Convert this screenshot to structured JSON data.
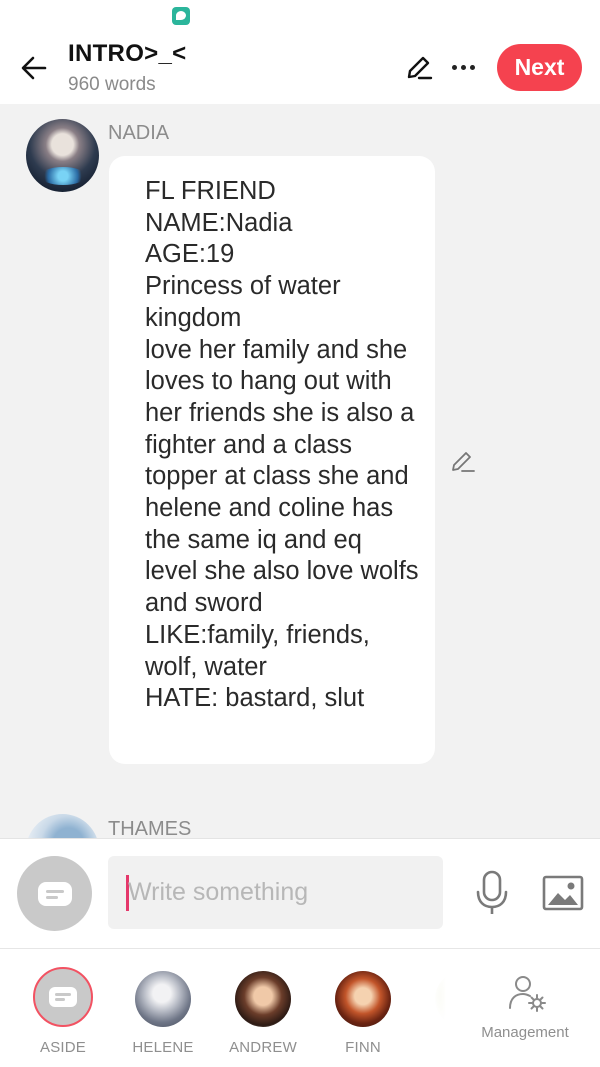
{
  "status_bar": {
    "app_icon": "chat-bubble-icon"
  },
  "header": {
    "title": "INTRO>_<",
    "word_count": "960 words",
    "back_icon": "arrow-left-icon",
    "edit_icon": "pencil-icon",
    "more_icon": "ellipsis-icon",
    "next_label": "Next",
    "accent_color": "#f5424f"
  },
  "messages": [
    {
      "speaker": "NADIA",
      "text": "FL FRIEND\nNAME:Nadia\nAGE:19\nPrincess of water kingdom\nlove her family and she loves to hang out with her friends she is also a fighter and a class topper at class she and helene and coline has the same iq and eq level she also love wolfs and sword\nLIKE:family, friends, wolf, water\nHATE: bastard, slut"
    },
    {
      "speaker": "THAMES"
    }
  ],
  "composer": {
    "placeholder": "Write something",
    "value": "",
    "aside_icon": "aside-text-icon",
    "mic_icon": "microphone-icon",
    "image_icon": "image-icon"
  },
  "characters": [
    {
      "label": "ASIDE",
      "selected": true
    },
    {
      "label": "HELENE"
    },
    {
      "label": "ANDREW"
    },
    {
      "label": "FINN"
    }
  ],
  "management": {
    "label": "Management",
    "icon": "user-settings-icon"
  }
}
